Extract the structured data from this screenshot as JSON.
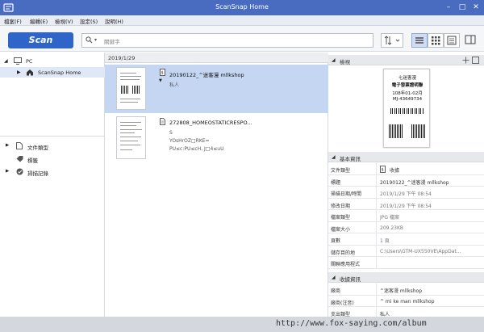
{
  "window": {
    "title": "ScanSnap Home"
  },
  "menu": [
    "檔案(F)",
    "編輯(E)",
    "檢視(V)",
    "設定(S)",
    "說明(H)"
  ],
  "toolbar": {
    "scan_label": "Scan",
    "search_placeholder": "關鍵字"
  },
  "tree": {
    "pc": "PC",
    "home": "ScanSnap Home"
  },
  "filters": [
    "文件類型",
    "標籤",
    "掃描記錄"
  ],
  "list": {
    "date": "2019/1/29",
    "items": [
      {
        "name": "20190122_^迷客漫 mllkshop",
        "sub1": "私人",
        "sub2": "",
        "sub3": ""
      },
      {
        "name": "272808_HOMEOSTATICRESPO...",
        "sub1": "S",
        "sub2": "YOsHrOZ□RKE=",
        "sub3": "PU≤c:PU≤cH, J□4≤uU"
      }
    ]
  },
  "preview": {
    "header": "檢視",
    "receipt": [
      "七迷客漫",
      "電子發票證明聯",
      "108年01-02月",
      "MJ-43649734"
    ]
  },
  "basic": {
    "header": "基本資訊",
    "rows": [
      {
        "k": "文件類型",
        "v": "收據"
      },
      {
        "k": "標題",
        "v": "20190122_^迷客漫 mllkshop"
      },
      {
        "k": "掃描日期/時間",
        "v": "2019/1/29 下午 08:54"
      },
      {
        "k": "修改日期",
        "v": "2019/1/29 下午 08:54"
      },
      {
        "k": "檔案類型",
        "v": "JPG 檔案"
      },
      {
        "k": "檔案大小",
        "v": "209.23KB"
      },
      {
        "k": "頁數",
        "v": "1 頁"
      },
      {
        "k": "儲存目的地",
        "v": "C:\\Users\\GTM-UX550VE\\AppDat..."
      },
      {
        "k": "關聯應用程式",
        "v": ""
      }
    ]
  },
  "receipt_info": {
    "header": "收據資訊",
    "rows": [
      {
        "k": "廠商",
        "v": "^迷客漫 mllkshop"
      },
      {
        "k": "廠商(注音)",
        "v": "^ mi ke man mllkshop"
      },
      {
        "k": "支出類型",
        "v": "私人"
      }
    ]
  },
  "watermark": "http://www.fox-saying.com/album"
}
